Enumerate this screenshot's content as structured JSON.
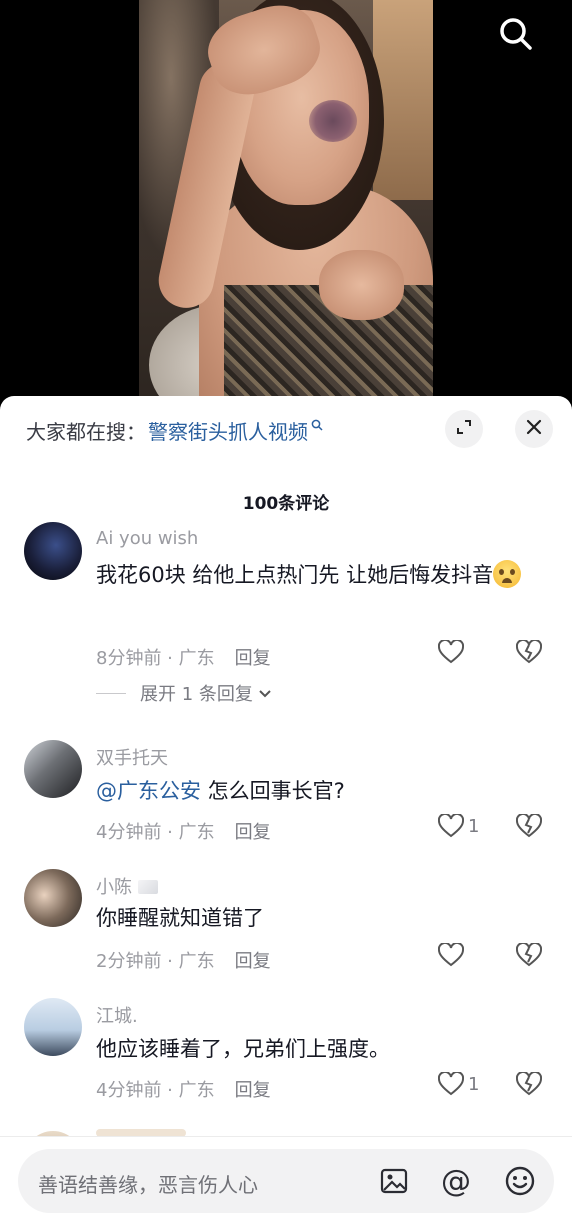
{
  "hot_search": {
    "label": "大家都在搜：",
    "term": "警察街头抓人视频"
  },
  "comments_count": "100条评论",
  "comments": [
    {
      "user": "Ai you wish",
      "text": "我花60块  给他上点热门先    让她后悔发抖音",
      "time": "8分钟前",
      "location": "广东",
      "reply_label": "回复",
      "likes": "",
      "expand_label": "展开 1 条回复"
    },
    {
      "user": "双手托天",
      "mention": "@广东公安",
      "text": " 怎么回事长官?",
      "time": "4分钟前",
      "location": "广东",
      "reply_label": "回复",
      "likes": "1"
    },
    {
      "user": "小陈",
      "text": "你睡醒就知道错了",
      "time": "2分钟前",
      "location": "广东",
      "reply_label": "回复",
      "likes": ""
    },
    {
      "user": "江城.",
      "text": "他应该睡着了，兄弟们上强度。",
      "time": "4分钟前",
      "location": "广东",
      "reply_label": "回复",
      "likes": "1"
    }
  ],
  "input": {
    "placeholder": "善语结善缘，恶言伤人心"
  },
  "icons": {
    "search": "search-icon",
    "expand": "expand-icon",
    "close": "close-icon",
    "like": "heart-icon",
    "dislike": "broken-heart-icon",
    "image": "image-icon",
    "at": "@",
    "emoji": "emoji-icon"
  },
  "colors": {
    "link": "#2a5f9e",
    "muted": "#9a9ba1",
    "text": "#161823"
  }
}
